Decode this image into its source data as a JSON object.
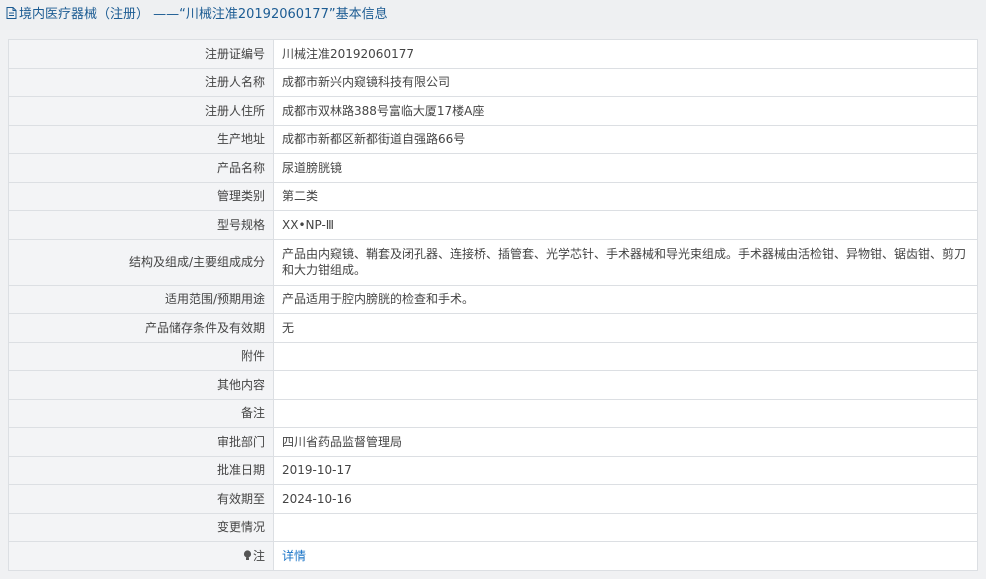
{
  "header": {
    "title": "境内医疗器械（注册） ——“川械注准20192060177”基本信息"
  },
  "rows": [
    {
      "label": "注册证编号",
      "value": "川械注准20192060177"
    },
    {
      "label": "注册人名称",
      "value": "成都市新兴内窥镜科技有限公司"
    },
    {
      "label": "注册人住所",
      "value": "成都市双林路388号富临大厦17楼A座"
    },
    {
      "label": "生产地址",
      "value": "成都市新都区新都街道自强路66号"
    },
    {
      "label": "产品名称",
      "value": "尿道膀胱镜"
    },
    {
      "label": "管理类别",
      "value": "第二类"
    },
    {
      "label": "型号规格",
      "value": "XX•NP-Ⅲ"
    },
    {
      "label": "结构及组成/主要组成成分",
      "value": "产品由内窥镜、鞘套及闭孔器、连接桥、插管套、光学芯针、手术器械和导光束组成。手术器械由活检钳、异物钳、锯齿钳、剪刀和大力钳组成。"
    },
    {
      "label": "适用范围/预期用途",
      "value": "产品适用于腔内膀胱的检查和手术。"
    },
    {
      "label": "产品储存条件及有效期",
      "value": "无"
    },
    {
      "label": "附件",
      "value": ""
    },
    {
      "label": "其他内容",
      "value": ""
    },
    {
      "label": "备注",
      "value": ""
    },
    {
      "label": "审批部门",
      "value": "四川省药品监督管理局"
    },
    {
      "label": "批准日期",
      "value": "2019-10-17"
    },
    {
      "label": "有效期至",
      "value": "2024-10-16"
    },
    {
      "label": "变更情况",
      "value": ""
    }
  ],
  "note_row": {
    "label": "注",
    "link": "详情"
  },
  "colors": {
    "header_text": "#1c5c93",
    "link": "#1a74c7",
    "label_bg": "#f3f4f6"
  }
}
